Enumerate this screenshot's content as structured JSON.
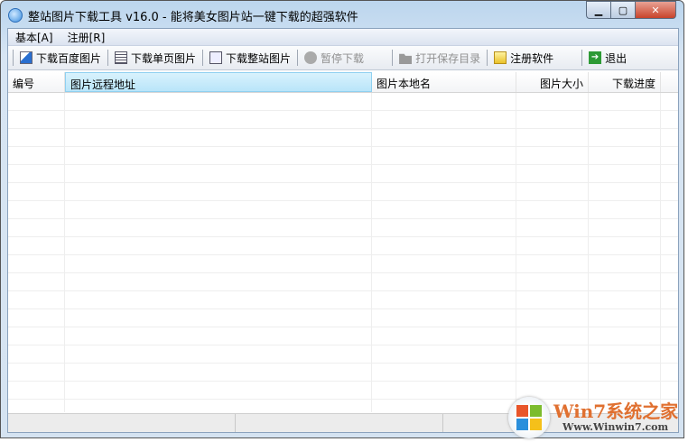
{
  "window": {
    "title": "整站图片下载工具 v16.0 - 能将美女图片站一键下载的超强软件",
    "minimize": "▁",
    "maximize": "▢",
    "close": "✕"
  },
  "menu": [
    {
      "label": "基本[A]"
    },
    {
      "label": "注册[R]"
    }
  ],
  "toolbar": [
    {
      "label": "下载百度图片",
      "icon": "ie-page-icon",
      "enabled": true
    },
    {
      "label": "下载单页图片",
      "icon": "page-icon",
      "enabled": true
    },
    {
      "label": "下载整站图片",
      "icon": "site-icon",
      "enabled": true
    },
    {
      "label": "暂停下载",
      "icon": "pause-icon",
      "enabled": false
    },
    {
      "label": "打开保存目录",
      "icon": "folder-icon",
      "enabled": false
    },
    {
      "label": "注册软件",
      "icon": "register-icon",
      "enabled": true
    },
    {
      "label": "退出",
      "icon": "exit-icon",
      "enabled": true
    }
  ],
  "table": {
    "columns": [
      "编号",
      "图片远程地址",
      "图片本地名",
      "图片大小",
      "下载进度"
    ],
    "rows": []
  },
  "watermark": {
    "brand": "Win7系统之家",
    "url": "Www.Winwin7.com"
  }
}
